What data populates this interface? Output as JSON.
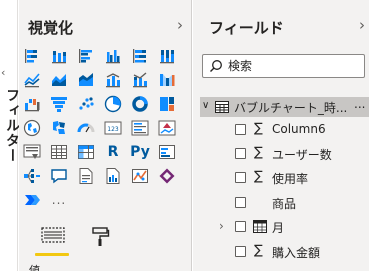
{
  "filters": {
    "label": "フィルター",
    "chevron": "‹"
  },
  "visualizations": {
    "title": "視覚化",
    "chevron": "›",
    "icons": [
      "stacked-bar-icon",
      "stacked-column-icon",
      "clustered-bar-icon",
      "clustered-column-icon",
      "100-percent-bar-icon",
      "100-percent-column-icon",
      "line-chart-icon",
      "area-chart-icon",
      "stacked-area-icon",
      "line-clustered-column-icon",
      "line-stacked-column-icon",
      "ribbon-chart-icon",
      "waterfall-chart-icon",
      "funnel-chart-icon",
      "scatter-chart-icon",
      "pie-chart-icon",
      "donut-chart-icon",
      "treemap-icon",
      "map-icon",
      "filled-map-icon",
      "gauge-icon",
      "card-icon",
      "multi-row-card-icon",
      "kpi-icon",
      "slicer-icon",
      "table-icon",
      "matrix-icon",
      "r-visual-icon",
      "python-visual-icon",
      "key-influencers-icon",
      "decomposition-tree-icon",
      "qa-icon",
      "smart-narrative-icon",
      "paginated-report-icon",
      "arcgis-map-icon",
      "power-apps-icon",
      "power-automate-icon",
      "more-visuals-icon"
    ],
    "r_label": "R",
    "py_label": "Py",
    "card_label": "123",
    "more_label": "...",
    "values_label": "値"
  },
  "fields": {
    "title": "フィールド",
    "chevron": "›",
    "search_placeholder": "検索",
    "table": {
      "name": "バブルチャート_時...",
      "more": "...",
      "expanded": true
    },
    "items": [
      {
        "name": "Column6",
        "sigma": "∑",
        "checked": false
      },
      {
        "name": "ユーザー数",
        "sigma": "∑",
        "checked": false
      },
      {
        "name": "使用率",
        "sigma": "∑",
        "checked": false
      },
      {
        "name": "商品",
        "sigma": "",
        "checked": false
      },
      {
        "name": "月",
        "sigma": "",
        "checked": false,
        "expandable": true,
        "date_icon": true
      },
      {
        "name": "購入金額",
        "sigma": "∑",
        "checked": false
      }
    ]
  },
  "colors": {
    "accent": "#f2c811",
    "brand_blue": "#118dff",
    "dark_blue": "#005a9e",
    "pane_bg": "#f3f2f1",
    "selected_row": "#c8c6c4"
  }
}
